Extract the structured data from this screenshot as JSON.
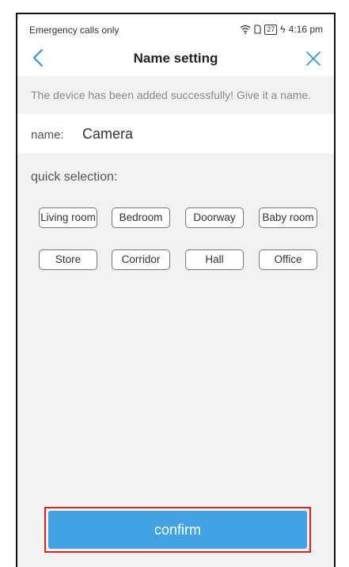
{
  "statusbar": {
    "carrier": "Emergency calls only",
    "battery": "27",
    "time": "4:16 pm"
  },
  "navbar": {
    "title": "Name setting",
    "back_icon": "chevron-left-icon",
    "close_icon": "close-icon"
  },
  "message": "The device has been added successfully! Give it a name.",
  "name": {
    "label": "name:",
    "value": "Camera"
  },
  "quick_selection": {
    "label": "quick selection:",
    "options": [
      "Living room",
      "Bedroom",
      "Doorway",
      "Baby room",
      "Store",
      "Corridor",
      "Hall",
      "Office"
    ]
  },
  "confirm_label": "confirm",
  "colors": {
    "accent": "#42a2e4",
    "highlight_border": "#e02020"
  }
}
